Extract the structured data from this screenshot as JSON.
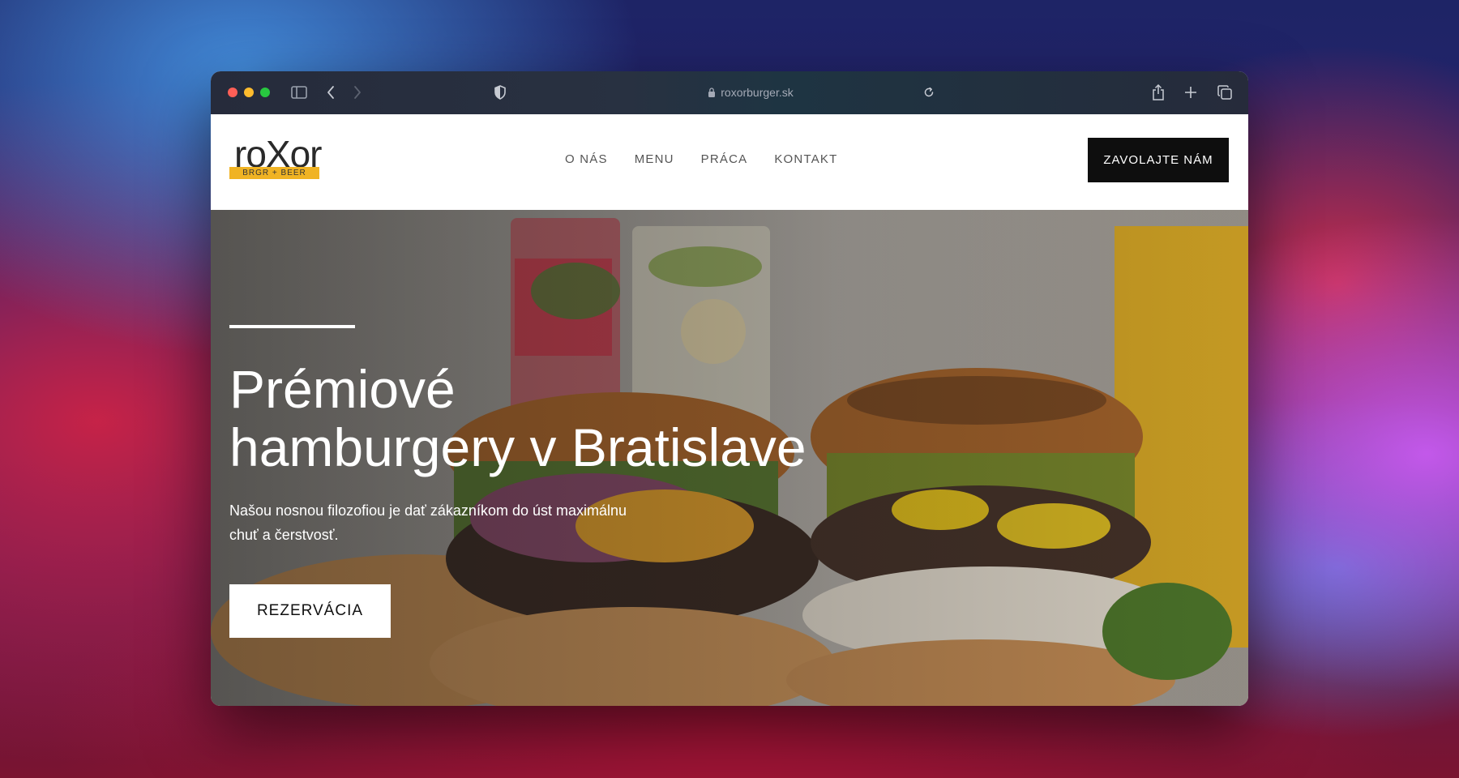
{
  "browser": {
    "url": "roxorburger.sk"
  },
  "site": {
    "logo": {
      "name": "roXor",
      "tagline": "BRGR + BEER",
      "color": "#f0b323"
    },
    "nav": [
      "O NÁS",
      "MENU",
      "PRÁCA",
      "KONTAKT"
    ],
    "cta_label": "ZAVOLAJTE NÁM",
    "hero": {
      "title_line1": "Prémiové",
      "title_line2": "hamburgery v Bratislave",
      "subtitle_line1": "Našou nosnou filozofiou je dať zákazníkom do úst maximálnu",
      "subtitle_line2": "chuť a čerstvosť.",
      "button_label": "REZERVÁCIA"
    }
  }
}
